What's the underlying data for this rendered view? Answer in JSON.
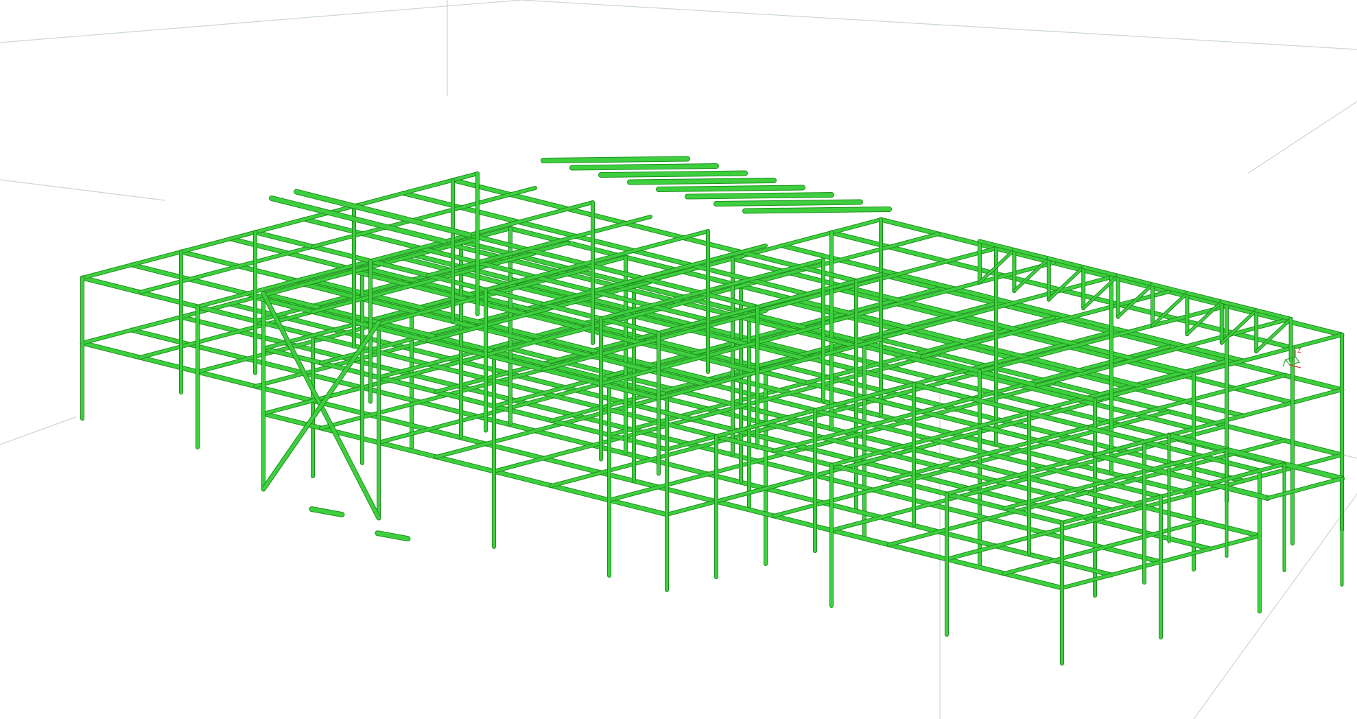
{
  "viewport": {
    "background": "#ffffff",
    "grid_color": "#c8d8c8",
    "model_color": "#3ecf3e",
    "model_edge_color": "#1f8f1f",
    "model_highlight_color": "#7ee87e"
  },
  "axis_triad": {
    "z_label": "Z",
    "x_color": "#e03030",
    "y_color": "#30a030",
    "z_color": "#e03030"
  }
}
